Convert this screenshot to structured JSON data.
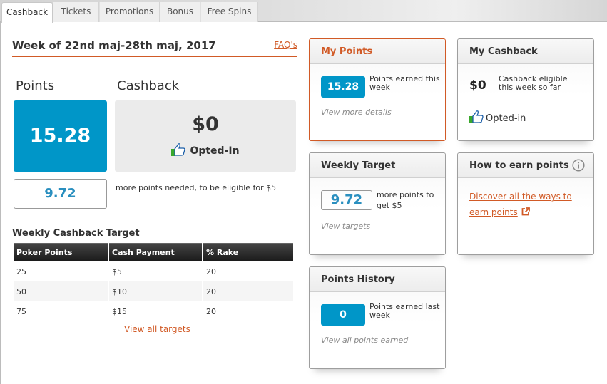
{
  "tabs": [
    {
      "label": "Cashback",
      "active": true
    },
    {
      "label": "Tickets",
      "active": false
    },
    {
      "label": "Promotions",
      "active": false
    },
    {
      "label": "Bonus",
      "active": false
    },
    {
      "label": "Free Spins",
      "active": false
    }
  ],
  "week": {
    "title": "Week of 22nd maj-28th maj, 2017",
    "faq_label": "FAQ's"
  },
  "summary": {
    "points_label": "Points",
    "points_value": "15.28",
    "cashback_label": "Cashback",
    "cashback_value": "$0",
    "opted_status": "Opted-In",
    "thumb_icon": "thumbs-up-icon",
    "needed_value": "9.72",
    "needed_text": "more points needed, to be eligible for $5"
  },
  "targets": {
    "title": "Weekly Cashback Target",
    "columns": [
      "Poker Points",
      "Cash Payment",
      "% Rake"
    ],
    "rows": [
      [
        "25",
        "$5",
        "20"
      ],
      [
        "50",
        "$10",
        "20"
      ],
      [
        "75",
        "$15",
        "20"
      ]
    ],
    "view_all_label": "View all targets"
  },
  "cards": {
    "my_points": {
      "title": "My Points",
      "value": "15.28",
      "text": "Points earned this week",
      "link": "View more details"
    },
    "my_cashback": {
      "title": "My Cashback",
      "value": "$0",
      "text": "Cashback eligible this week so far",
      "opted": "Opted-in"
    },
    "weekly_target": {
      "title": "Weekly Target",
      "value": "9.72",
      "text": "more points to get $5",
      "link": "View targets"
    },
    "how_to_earn": {
      "title": "How to earn points",
      "info_icon": "info-icon",
      "link": "Discover all the ways to earn points",
      "link_icon": "external-link-icon"
    },
    "points_history": {
      "title": "Points History",
      "value": "0",
      "text": "Points earned last week",
      "link": "View all points earned"
    }
  },
  "colors": {
    "accent": "#d15a26",
    "points_blue": "#0096c8",
    "target_text_blue": "#2a8fbf",
    "thumb_green": "#3aa82c"
  }
}
